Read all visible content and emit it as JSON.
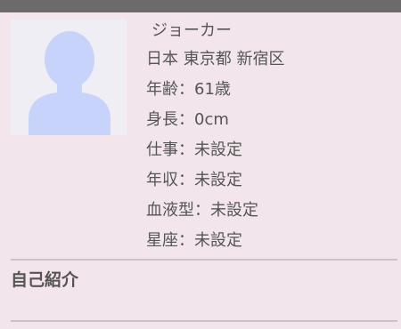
{
  "profile": {
    "name": "ジョーカー",
    "location": "日本 東京都 新宿区",
    "age": "年齢：61歳",
    "height": "身長：0cm",
    "job": "仕事：未設定",
    "income": "年収：未設定",
    "blood_type": "血液型：未設定",
    "zodiac": "星座：未設定"
  },
  "sections": {
    "self_intro_title": "自己紹介"
  },
  "colors": {
    "background": "#f2e6ec",
    "top_bar": "#6b6b6b",
    "avatar_silhouette": "#c7d3fb",
    "avatar_background": "#eeeef4",
    "text": "#555555",
    "divider": "#c9c2c7"
  },
  "icons": {
    "avatar": "default-user-silhouette-icon"
  }
}
